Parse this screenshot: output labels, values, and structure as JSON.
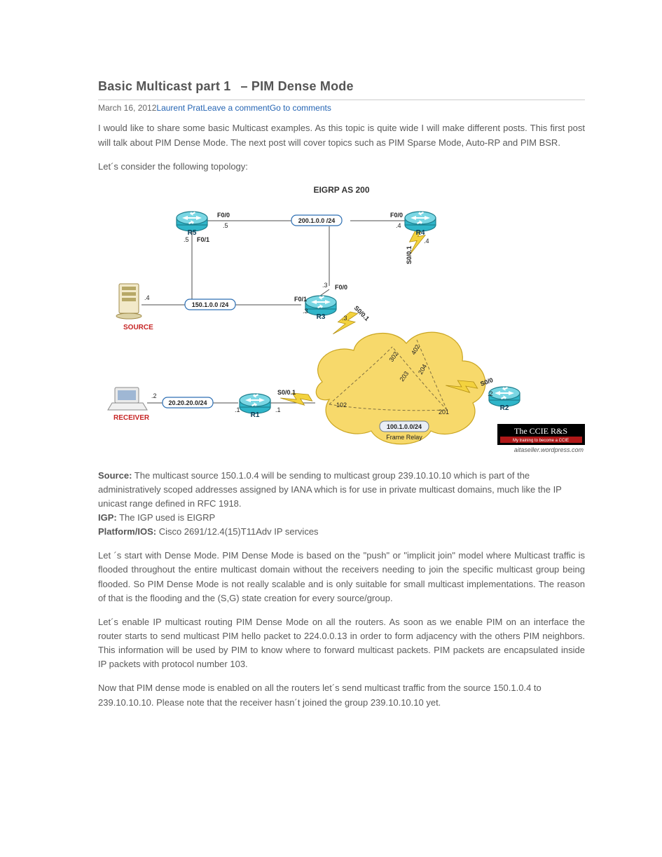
{
  "post": {
    "title_part1": "Basic Multicast part 1",
    "title_part2": "– PIM Dense Mode",
    "date": "March 16, 2012",
    "author": "Laurent Prat",
    "leave_comment": "Leave a comment",
    "goto_comments": "Go to comments"
  },
  "body": {
    "intro": "I would like to share some basic Multicast examples. As this topic is quite wide I will make different posts. This first post will talk about PIM Dense Mode. The next post will cover topics such as PIM Sparse Mode, Auto-RP and PIM BSR.",
    "consider": "Let´s consider the following topology:",
    "source_label": "Source:",
    "source_text": " The multicast source 150.1.0.4 will be sending to multicast group 239.10.10.10 which is part of the administratively scoped addresses assigned by IANA which is for use in private multicast domains, much like the IP unicast range defined in RFC 1918.",
    "igp_label": "IGP:",
    "igp_text": " The IGP used is EIGRP",
    "platform_label": "Platform/IOS:",
    "platform_text": " Cisco 2691/12.4(15)T11Adv IP services",
    "dense_intro": "Let ´s start with Dense Mode. PIM Dense Mode is based on the \"push\" or \"implicit join\" model where Multicast traffic is flooded throughout the entire multicast domain without the receivers needing to join the specific multicast group being flooded. So PIM Dense Mode is not really scalable and is only suitable for small multicast implementations. The reason of that is the flooding and the (S,G) state creation for every source/group.",
    "enable_para": "Let´s enable IP multicast routing PIM Dense Mode on all the routers. As soon as we enable PIM on an interface the router starts to send multicast PIM hello packet to 224.0.0.13 in order to form adjacency with the others PIM neighbors. This information will be used by PIM to know where to forward multicast packets. PIM packets are encapsulated inside IP packets with protocol number 103.",
    "now_para": "Now that PIM dense mode is enabled on all the routers let´s send multicast traffic from the source 150.1.0.4 to 239.10.10.10. Please note that the receiver hasn´t joined the group 239.10.10.10 yet."
  },
  "diagram": {
    "title": "EIGRP AS 200",
    "routers": {
      "r1": "R1",
      "r2": "R2",
      "r3": "R3",
      "r4": "R4",
      "r5": "R5"
    },
    "hosts": {
      "source": "SOURCE",
      "receiver": "RECEIVER"
    },
    "subnets": {
      "top": "200.1.0.0 /24",
      "left": "150.1.0.0 /24",
      "recv": "20.20.20.0/24",
      "fr": "100.1.0.0/24"
    },
    "ifaces": {
      "r5_f00": "F0/0",
      "r5_f01": "F0/1",
      "r4_f00": "F0/0",
      "r4_s001": "S0/0.1",
      "r3_f00": "F0/0",
      "r3_f01": "F0/1",
      "r3_s001": "S0/0.1",
      "r2_s00": "S0/0",
      "r1_s001": "S0/0.1"
    },
    "ips": {
      "r5_top": ".5",
      "r5_left": ".5",
      "r4_top": ".4",
      "r4_fr": ".4",
      "r3_top": ".3",
      "r3_left": ".3",
      "r3_fr": ".3",
      "r2_fr": ".2",
      "r1_lan": ".1",
      "r1_fr": ".1",
      "source": ".4",
      "receiver": ".2"
    },
    "dlci": {
      "d102": "102",
      "d201": "201",
      "d203": "203",
      "d204": "204",
      "d302": "302",
      "d402": "402"
    },
    "fr_caption": "Frame Relay",
    "badge": {
      "line1": "The CCIE R&S",
      "line2": "My training to become a CCIE",
      "url": "aitaseller.wordpress.com"
    }
  }
}
